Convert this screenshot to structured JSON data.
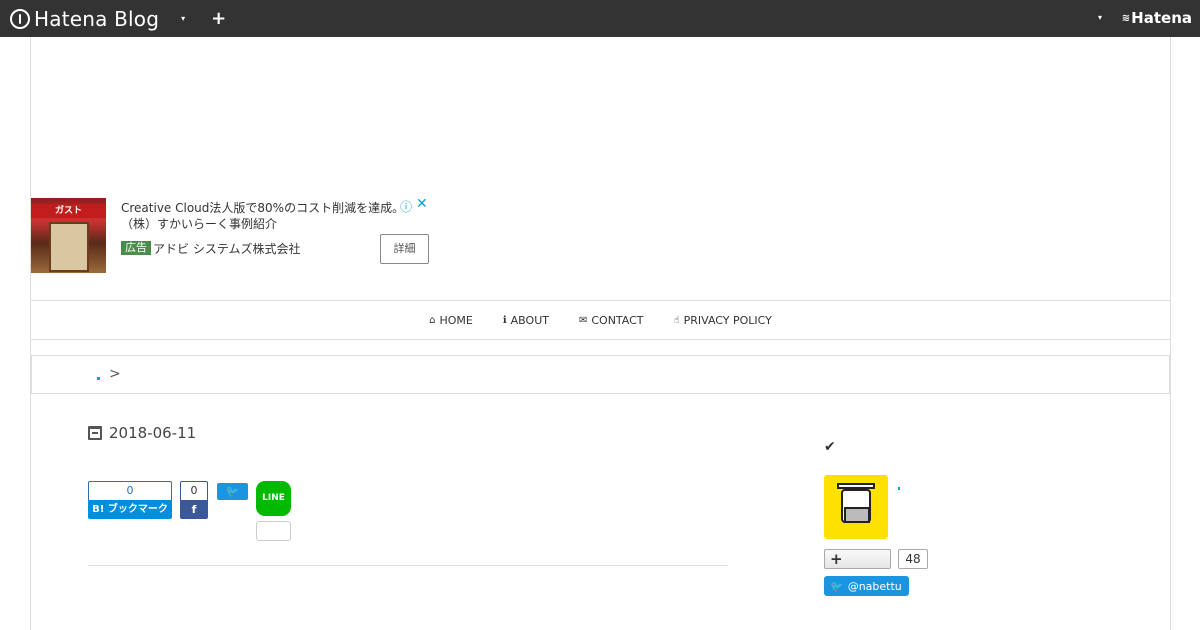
{
  "topbar": {
    "brand": "Hatena Blog",
    "menu_caret": "▾",
    "add_label": "+",
    "account_caret": "▾",
    "hatena_logo": "Hatena"
  },
  "ad": {
    "title": "Creative Cloud法人版で80%のコスト削減を達成。（株）すかいらーく事例紹介",
    "image_sign": "ガスト",
    "info_icon": "ⓘ",
    "close_icon": "✕",
    "label": "広告",
    "sponsor": "アドビ システムズ株式会社",
    "detail_button": "詳細"
  },
  "nav": {
    "items": [
      {
        "icon": "⌂",
        "label": "HOME"
      },
      {
        "icon": "ℹ",
        "label": "ABOUT"
      },
      {
        "icon": "✉",
        "label": "CONTACT"
      },
      {
        "icon": "☝",
        "label": "PRIVACY POLICY"
      }
    ]
  },
  "breadcrumb": {
    "separator": ">"
  },
  "article": {
    "date": "2018-06-11"
  },
  "share": {
    "hatena_count": "0",
    "hatena_label": "B! ブックマーク",
    "facebook_count": "0",
    "facebook_label": "f",
    "twitter_label": "🐦",
    "line_label": "LINE"
  },
  "sidebar": {
    "check_icon": "✔",
    "follow_label": "+",
    "follow_count": "48",
    "twitter_handle": "@nabettu"
  }
}
